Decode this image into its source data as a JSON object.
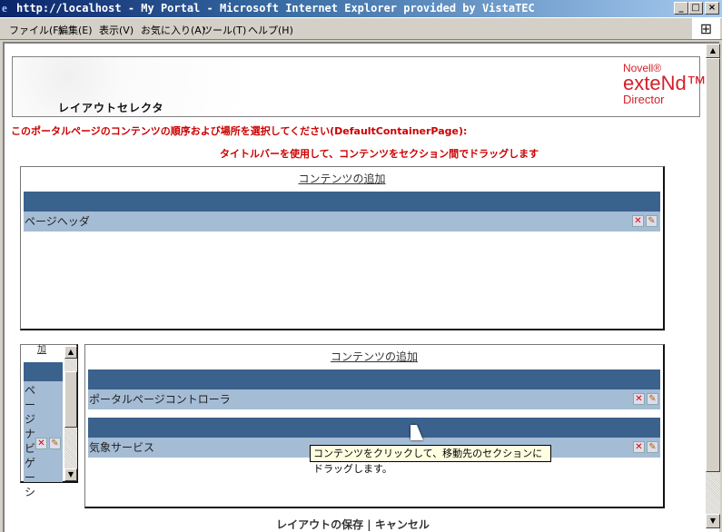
{
  "window": {
    "title": "http://localhost - My Portal - Microsoft Internet Explorer provided by VistaTEC",
    "controls": {
      "minimize": "_",
      "maximize": "□",
      "close": "×"
    }
  },
  "menu": [
    "ファイル(F)",
    "編集(E)",
    "表示(V)",
    "お気に入り(A)",
    "ツール(T)",
    "ヘルプ(H)"
  ],
  "header": {
    "title": "レイアウトセレクタ",
    "logo": {
      "brand": "Novell®",
      "product": "exteNd™",
      "sub": "Director"
    }
  },
  "instructions": {
    "line1": "このポータルページのコンテンツの順序および場所を選択してください(DefaultContainerPage):",
    "line2": "タイトルバーを使用して、コンテンツをセクション間でドラッグします"
  },
  "sections": {
    "top": {
      "add_link": "コンテンツの追加",
      "portlets": [
        {
          "title": "ページヘッダ"
        }
      ]
    },
    "left": {
      "add_link": "加",
      "portlets": [
        {
          "title": "ページナビゲーシ"
        }
      ]
    },
    "right": {
      "add_link": "コンテンツの追加",
      "portlets": [
        {
          "title": "ポータルページコントローラ"
        },
        {
          "title": "気象サービス"
        }
      ]
    }
  },
  "icons": {
    "delete": "delete-icon",
    "edit": "edit-icon"
  },
  "tooltip": "コンテンツをクリックして、移動先のセクションにドラッグします。",
  "footer": {
    "save": "レイアウトの保存",
    "separator": "|",
    "cancel": "キャンセル"
  },
  "colors": {
    "titlebar_dark": "#3a628d",
    "portlet_body": "#a5bcd5",
    "instructions": "#cc0000",
    "logo": "#d4202a"
  }
}
